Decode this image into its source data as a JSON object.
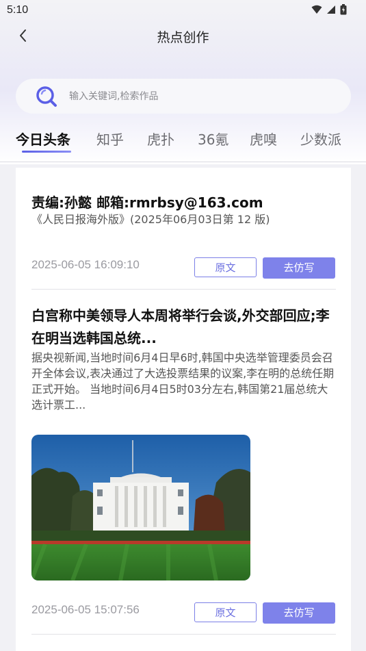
{
  "status": {
    "time": "5:10"
  },
  "header": {
    "title": "热点创作"
  },
  "search": {
    "placeholder": "输入关键词,检索作品",
    "value": ""
  },
  "tabs": [
    {
      "label": "今日头条",
      "active": true
    },
    {
      "label": "知乎"
    },
    {
      "label": "虎扑"
    },
    {
      "label": "36氪"
    },
    {
      "label": "虎嗅"
    },
    {
      "label": "少数派"
    }
  ],
  "articles": [
    {
      "title": "责编:孙懿 邮箱:rmrbsy@163.com",
      "summary": "《人民日报海外版》(2025年06月03日第 12 版)",
      "date": "2025-06-05 16:09:10",
      "btn_original": "原文",
      "btn_imitate": "去仿写"
    },
    {
      "title": "白宫称中美领导人本周将举行会谈,外交部回应;李在明当选韩国总统...",
      "summary": "据央视新闻,当地时间6月4日早6时,韩国中央选举管理委员会召开全体会议,表决通过了大选投票结果的议案,李在明的总统任期正式开始。 当地时间6月4日5时03分左右,韩国第21届总统大选计票工...",
      "date": "2025-06-05 15:07:56",
      "btn_original": "原文",
      "btn_imitate": "去仿写"
    }
  ],
  "colors": {
    "accent": "#7e82ea",
    "accent_dark": "#5b5fe6"
  }
}
